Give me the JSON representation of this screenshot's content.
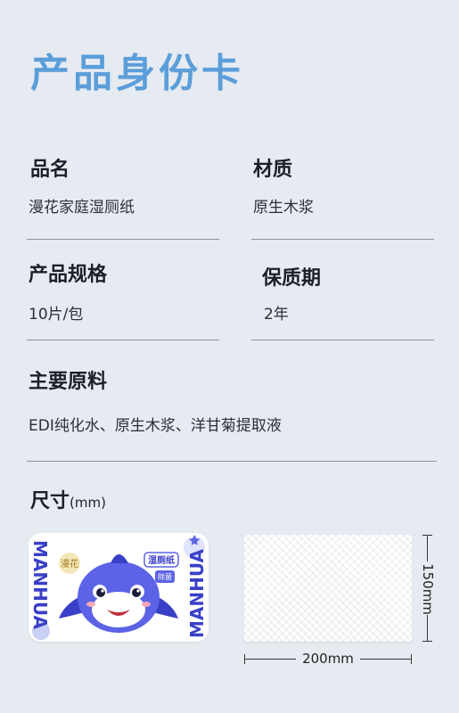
{
  "title": "产品身份卡",
  "fields": {
    "name": {
      "label": "品名",
      "value": "漫花家庭湿厕纸"
    },
    "material": {
      "label": "材质",
      "value": "原生木浆"
    },
    "spec": {
      "label": "产品规格",
      "value": "10片/包"
    },
    "shelf_life": {
      "label": "保质期",
      "value": "2年"
    },
    "ingredients": {
      "label": "主要原料",
      "value": "EDI纯化水、原生木浆、洋甘菊提取液"
    }
  },
  "size": {
    "label": "尺寸",
    "unit": "(mm)",
    "width_label": "200mm",
    "height_label": "150mm"
  },
  "package": {
    "brand_text": "MANHUA",
    "logo_text": "漫花",
    "product_badge": "湿厕纸",
    "sub_badge": "除菌"
  },
  "colors": {
    "title": "#5b9ed9",
    "background": "#e6ebf2",
    "brand_blue": "#3a3fc8",
    "mascot_blue": "#5c63e6"
  }
}
